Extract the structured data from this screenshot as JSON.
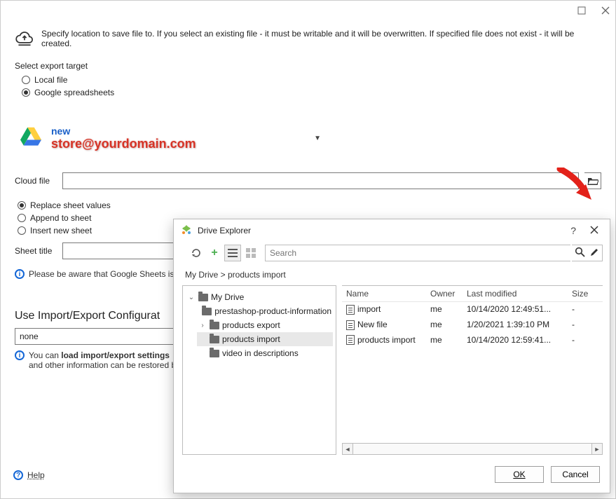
{
  "window": {
    "hint": "Specify location to save file to. If you select an existing file - it must be writable and it will be overwritten. If specified file does not exist - it will be created."
  },
  "target": {
    "label": "Select export target",
    "local": "Local file",
    "google": "Google spreadsheets",
    "selected": "google"
  },
  "account": {
    "name": "new",
    "email": "store@yourdomain.com"
  },
  "cloud_file": {
    "label": "Cloud file",
    "value": ""
  },
  "sheet_mode": {
    "replace": "Replace sheet values",
    "append": "Append to sheet",
    "insert": "Insert new sheet",
    "selected": "replace"
  },
  "sheet_title": {
    "label": "Sheet title",
    "value": ""
  },
  "sheets_warning": "Please be aware that Google Sheets is l",
  "config": {
    "heading": "Use Import/Export Configurat",
    "value": "none",
    "tip_bold": "load import/export settings",
    "tip_prefix": "You can ",
    "tip_line2": "and other information can be restored by"
  },
  "help": "Help",
  "explorer": {
    "title": "Drive Explorer",
    "search_placeholder": "Search",
    "breadcrumb": "My Drive  >  products import",
    "tree": [
      {
        "label": "My Drive",
        "level": 0,
        "expanded": true,
        "selected": false
      },
      {
        "label": "prestashop-product-information",
        "level": 1,
        "expanded": null,
        "selected": false
      },
      {
        "label": "products export",
        "level": 1,
        "expanded": false,
        "selected": false
      },
      {
        "label": "products import",
        "level": 1,
        "expanded": null,
        "selected": true
      },
      {
        "label": "video in descriptions",
        "level": 1,
        "expanded": null,
        "selected": false
      }
    ],
    "columns": {
      "name": "Name",
      "owner": "Owner",
      "modified": "Last modified",
      "size": "Size"
    },
    "files": [
      {
        "name": "import",
        "owner": "me",
        "modified": "10/14/2020 12:49:51...",
        "size": "-"
      },
      {
        "name": "New file",
        "owner": "me",
        "modified": "1/20/2021 1:39:10 PM",
        "size": "-"
      },
      {
        "name": "products import",
        "owner": "me",
        "modified": "10/14/2020 12:59:41...",
        "size": "-"
      }
    ],
    "ok": "OK",
    "cancel": "Cancel"
  }
}
